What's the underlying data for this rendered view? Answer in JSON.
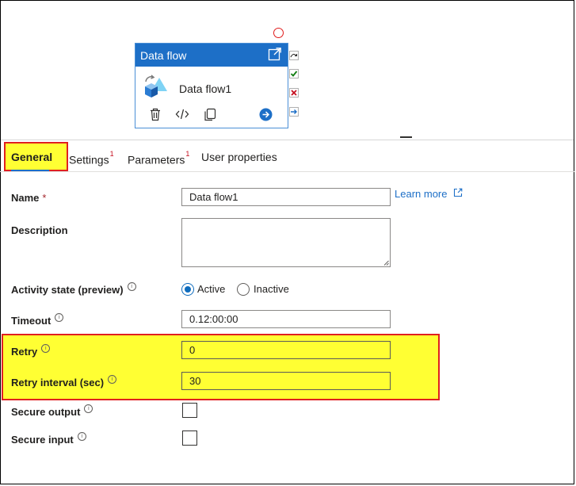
{
  "canvas": {
    "activity": {
      "header_title": "Data flow",
      "name": "Data flow1",
      "icons": {
        "open": "open-external-icon",
        "type": "data-flow-icon",
        "delete": "trash-icon",
        "code": "code-icon",
        "copy": "copy-icon",
        "go": "arrow-right-circle-icon"
      }
    },
    "side_icons": [
      "skip-icon",
      "success-check-icon",
      "failure-x-icon",
      "completion-arrow-icon"
    ]
  },
  "tabs": [
    {
      "label": "General",
      "badge": ""
    },
    {
      "label": "Settings",
      "badge": "1"
    },
    {
      "label": "Parameters",
      "badge": "1"
    },
    {
      "label": "User properties",
      "badge": ""
    }
  ],
  "form": {
    "name_label": "Name",
    "required_marker": "*",
    "name_value": "Data flow1",
    "learn_more": "Learn more",
    "description_label": "Description",
    "description_value": "",
    "activity_state_label": "Activity state (preview)",
    "activity_state_options": [
      "Active",
      "Inactive"
    ],
    "activity_state_selected": "Active",
    "timeout_label": "Timeout",
    "timeout_value": "0.12:00:00",
    "retry_label": "Retry",
    "retry_value": "0",
    "retry_interval_label": "Retry interval (sec)",
    "retry_interval_value": "30",
    "secure_output_label": "Secure output",
    "secure_output_checked": false,
    "secure_input_label": "Secure input",
    "secure_input_checked": false,
    "info_glyph": "i"
  },
  "colors": {
    "accent": "#1d6fc7",
    "highlight": "#ffff33",
    "highlight_border": "#e02020",
    "required": "#a4262c",
    "success": "#107c10",
    "failure": "#c50f1f"
  }
}
